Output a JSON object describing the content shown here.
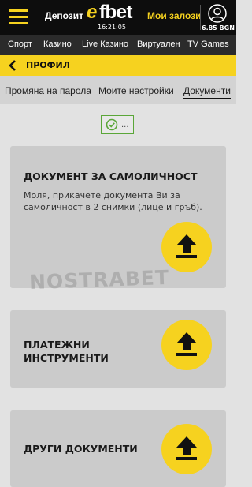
{
  "header": {
    "deposit_label": "Депозит",
    "logo_e": "e",
    "logo_rest": "fbet",
    "time": "16:21:05",
    "my_bets_label": "Мои залози",
    "balance": "6.85 BGN"
  },
  "nav": {
    "items": [
      "Спорт",
      "Казино",
      "Live Казино",
      "Виртуален",
      "TV Games"
    ]
  },
  "profile": {
    "title": "ПРОФИЛ"
  },
  "subnav": {
    "items": [
      "Промяна на парола",
      "Моите настройки",
      "Документи"
    ],
    "active": "Документи"
  },
  "status": {
    "dots": "..."
  },
  "cards": [
    {
      "title": "ДОКУМЕНТ ЗА САМОЛИЧНОСТ",
      "description": "Моля, прикачете документа Ви за самоличност в 2 снимки (лице и гръб)."
    },
    {
      "title_line1": "ПЛАТЕЖНИ",
      "title_line2": "ИНСТРУМЕНТИ"
    },
    {
      "title": "ДРУГИ ДОКУМЕНТИ"
    }
  ],
  "watermark": "NOSTRABET",
  "colors": {
    "brand_yellow": "#f6d21f",
    "header_bg": "#0d0d0d",
    "nav_bg": "#2b2b2b",
    "page_bg": "#e2e2e2",
    "card_bg": "#cbcbcb",
    "check_green": "#5aa638"
  }
}
